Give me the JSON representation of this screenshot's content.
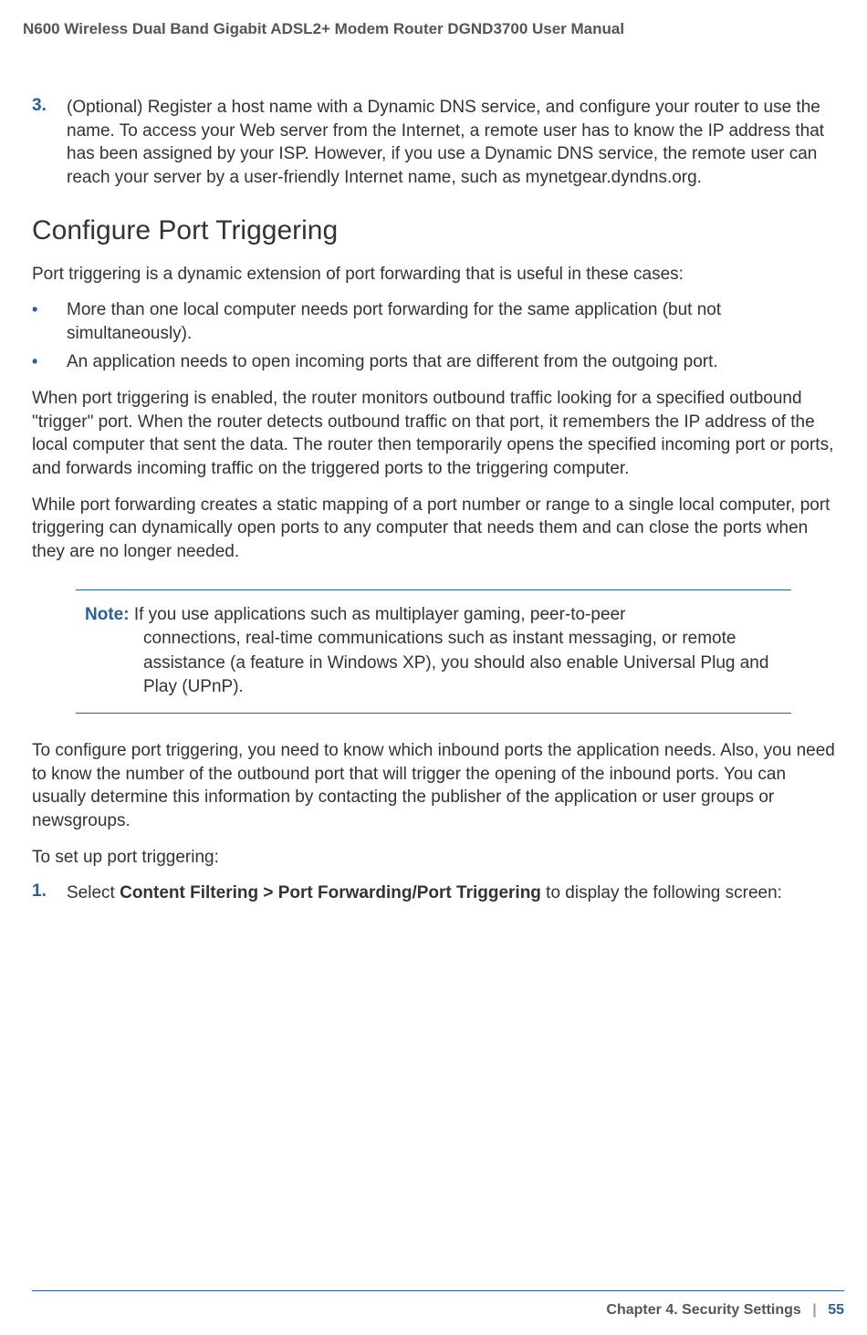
{
  "header": {
    "title": "N600 Wireless Dual Band Gigabit ADSL2+ Modem Router DGND3700 User Manual"
  },
  "body": {
    "step3": {
      "num": "3.",
      "text": "(Optional) Register a host name with a Dynamic DNS service, and configure your router to use the name. To access your Web server from the Internet, a remote user has to know the IP address that has been assigned by your ISP. However, if you use a Dynamic DNS service, the remote user can reach your server by a user-friendly Internet name, such as mynetgear.dyndns.org."
    },
    "heading": "Configure Port Triggering",
    "intro": "Port triggering is a dynamic extension of port forwarding that is useful in these cases:",
    "bullets": [
      "More than one local computer needs port forwarding for the same application (but not simultaneously).",
      "An application needs to open incoming ports that are different from the outgoing port."
    ],
    "para2": "When port triggering is enabled, the router monitors outbound traffic looking for a specified outbound \"trigger\" port. When the router detects outbound traffic on that port, it remembers the IP address of the local computer that sent the data. The router then temporarily opens the specified incoming port or ports, and forwards incoming traffic on the triggered ports to the triggering computer.",
    "para3": "While port forwarding creates a static mapping of a port number or range to a single local computer, port triggering can dynamically open ports to any computer that needs them and can close the ports when they are no longer needed.",
    "note": {
      "label": "Note:",
      "first_line": "If you use applications such as multiplayer gaming, peer-to-peer",
      "rest": "connections, real-time communications such as instant messaging, or remote assistance (a feature in Windows XP), you should also enable Universal Plug and Play (UPnP)."
    },
    "para4": "To configure port triggering, you need to know which inbound ports the application needs. Also, you need to know the number of the outbound port that will trigger the opening of the inbound ports. You can usually determine this information by contacting the publisher of the application or user groups or newsgroups.",
    "para5": "To set up port triggering:",
    "step1": {
      "num": "1.",
      "prefix": "Select ",
      "bold": "Content Filtering > Port Forwarding/Port Triggering",
      "suffix": " to display the following screen:"
    }
  },
  "footer": {
    "chapter": "Chapter 4.  Security Settings",
    "page": "55"
  }
}
